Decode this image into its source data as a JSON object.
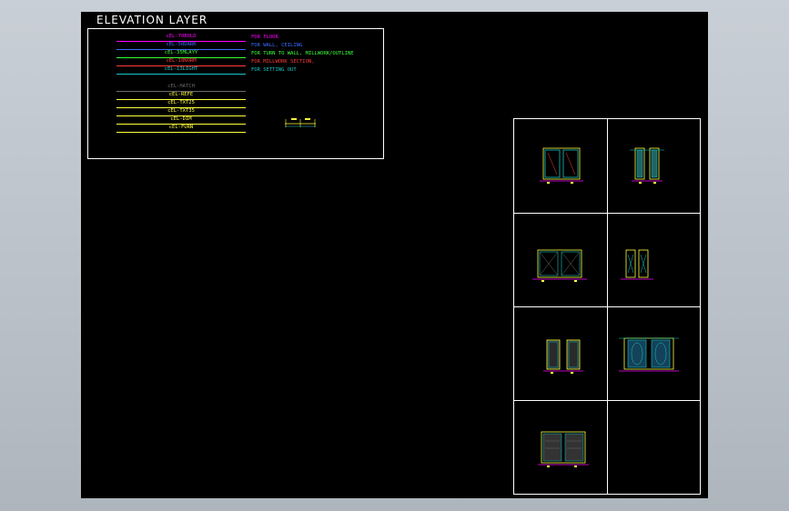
{
  "drawing": {
    "title": "ELEVATION LAYER",
    "layers": [
      {
        "name": "cEL-70BOLD",
        "color": "#ff00ff",
        "desc": "FOR FLOOR",
        "desc_color": "#ff00ff"
      },
      {
        "name": "cEL-50DARK",
        "color": "#3f6bff",
        "desc": "FOR WALL, CEILING",
        "desc_color": "#3f6bff"
      },
      {
        "name": "cEL-35MLAYY",
        "color": "#3bff3b",
        "desc": "FOR TURN TO WALL, MILLWORK/OUTLINE",
        "desc_color": "#3bff3b"
      },
      {
        "name": "cEL-18NORM",
        "color": "#ff3b3b",
        "desc": "FOR MILLWORK SECTION,",
        "desc_color": "#ff3b3b"
      },
      {
        "name": "cEL-13LIGHT",
        "color": "#17c6c6",
        "desc": "FOR SETTING OUT",
        "desc_color": "#17c6c6"
      },
      {
        "name": "cEL-HATCH",
        "color": "#6b6b6b",
        "desc": "",
        "desc_color": "#6b6b6b"
      },
      {
        "name": "cEL-REFE",
        "color": "#ffff3b",
        "desc": "",
        "desc_color": "#ffff3b"
      },
      {
        "name": "cEL-TXT25",
        "color": "#ffff3b",
        "desc": "",
        "desc_color": "#ffff3b"
      },
      {
        "name": "cEL-TXT35",
        "color": "#ffff3b",
        "desc": "",
        "desc_color": "#ffff3b"
      },
      {
        "name": "cEL-DIM",
        "color": "#ffff3b",
        "desc": "",
        "desc_color": "#ffff3b"
      },
      {
        "name": "cEL-FURN",
        "color": "#ffff3b",
        "desc": "",
        "desc_color": "#ffff3b"
      }
    ],
    "colors": {
      "background": "#000000",
      "frame": "#ffffff",
      "yellow": "#ffff3b",
      "cyan": "#17c6c6",
      "magenta": "#ff00ff",
      "red": "#ff3b3b"
    }
  }
}
